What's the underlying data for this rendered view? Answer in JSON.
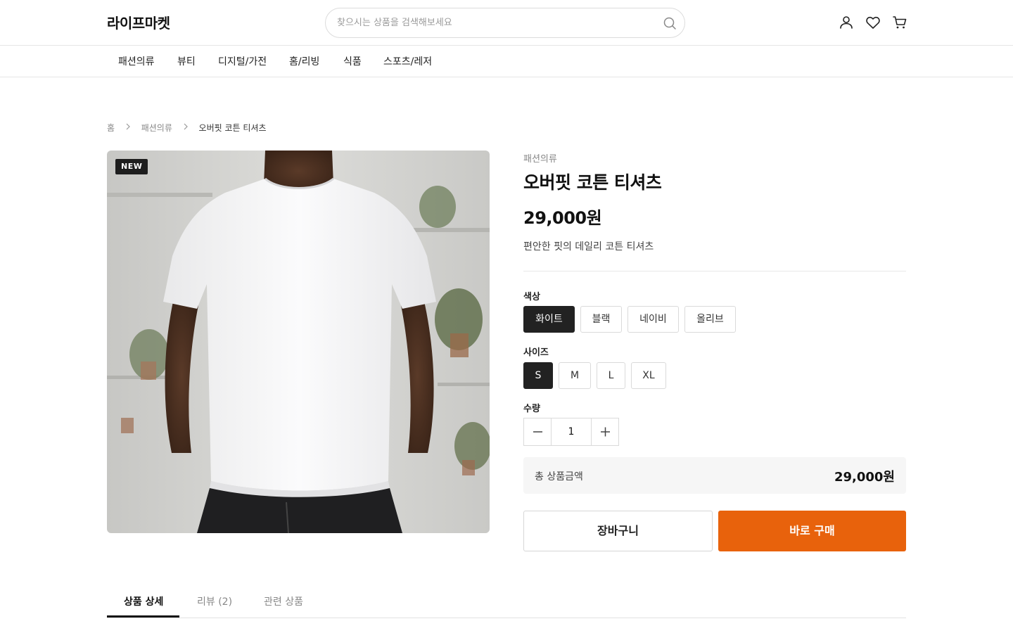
{
  "header": {
    "logo": "라이프마켓",
    "search_placeholder": "찾으시는 상품을 검색해보세요",
    "icons": [
      "user-icon",
      "heart-icon",
      "cart-icon"
    ]
  },
  "categories": [
    "패션의류",
    "뷰티",
    "디지털/가전",
    "홈/리빙",
    "식품",
    "스포츠/레저"
  ],
  "breadcrumb": [
    "홈",
    "패션의류",
    "오버핏 코튼 티셔츠"
  ],
  "product": {
    "badge": "NEW",
    "category": "패션의류",
    "title": "오버핏 코튼 티셔츠",
    "price": "29,000원",
    "description": "편안한 핏의 데일리 코튼 티셔츠",
    "color_label": "색상",
    "colors": [
      "화이트",
      "블랙",
      "네이비",
      "올리브"
    ],
    "selected_color": "화이트",
    "size_label": "사이즈",
    "sizes": [
      "S",
      "M",
      "L",
      "XL"
    ],
    "selected_size": "S",
    "quantity_label": "수량",
    "quantity": "1",
    "total_label": "총 상품금액",
    "total_amount": "29,000원",
    "cart_button": "장바구니",
    "buy_button": "바로 구매"
  },
  "tabs": [
    "상품 상세",
    "리뷰 (2)",
    "관련 상품"
  ],
  "active_tab": "상품 상세",
  "colors": {
    "accent": "#e8620c",
    "selected": "#222222"
  }
}
